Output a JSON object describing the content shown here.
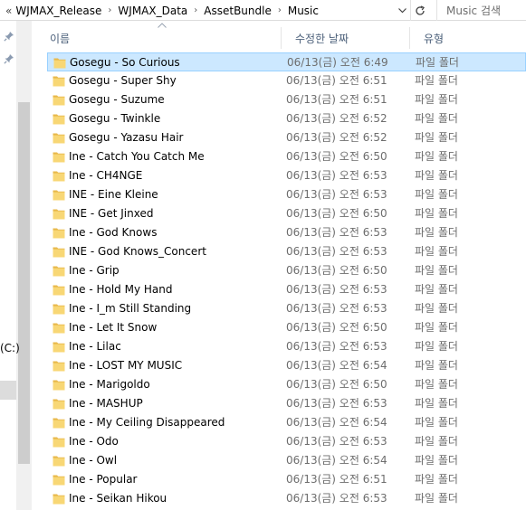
{
  "address": {
    "lead": "«",
    "crumbs": [
      "WJMAX_Release",
      "WJMAX_Data",
      "AssetBundle",
      "Music"
    ],
    "separator": "›"
  },
  "search": {
    "placeholder": "Music 검색"
  },
  "nav": {
    "drive_label": "(C:)"
  },
  "columns": {
    "name": "이름",
    "date": "수정한 날짜",
    "type": "유형"
  },
  "files": [
    {
      "name": "Gosegu - So Curious",
      "date": "06/13(금) 오전 6:49",
      "type": "파일 폴더"
    },
    {
      "name": "Gosegu - Super Shy",
      "date": "06/13(금) 오전 6:51",
      "type": "파일 폴더"
    },
    {
      "name": "Gosegu - Suzume",
      "date": "06/13(금) 오전 6:51",
      "type": "파일 폴더"
    },
    {
      "name": "Gosegu - Twinkle",
      "date": "06/13(금) 오전 6:52",
      "type": "파일 폴더"
    },
    {
      "name": "Gosegu - Yazasu Hair",
      "date": "06/13(금) 오전 6:52",
      "type": "파일 폴더"
    },
    {
      "name": "Ine - Catch You Catch Me",
      "date": "06/13(금) 오전 6:50",
      "type": "파일 폴더"
    },
    {
      "name": "Ine - CH4NGE",
      "date": "06/13(금) 오전 6:53",
      "type": "파일 폴더"
    },
    {
      "name": "INE - Eine Kleine",
      "date": "06/13(금) 오전 6:53",
      "type": "파일 폴더"
    },
    {
      "name": "INE - Get Jinxed",
      "date": "06/13(금) 오전 6:50",
      "type": "파일 폴더"
    },
    {
      "name": "Ine - God Knows",
      "date": "06/13(금) 오전 6:53",
      "type": "파일 폴더"
    },
    {
      "name": "INE - God Knows_Concert",
      "date": "06/13(금) 오전 6:53",
      "type": "파일 폴더"
    },
    {
      "name": "Ine - Grip",
      "date": "06/13(금) 오전 6:50",
      "type": "파일 폴더"
    },
    {
      "name": "Ine - Hold My Hand",
      "date": "06/13(금) 오전 6:53",
      "type": "파일 폴더"
    },
    {
      "name": "Ine - I_m Still Standing",
      "date": "06/13(금) 오전 6:53",
      "type": "파일 폴더"
    },
    {
      "name": "Ine - Let It Snow",
      "date": "06/13(금) 오전 6:50",
      "type": "파일 폴더"
    },
    {
      "name": "Ine - Lilac",
      "date": "06/13(금) 오전 6:53",
      "type": "파일 폴더"
    },
    {
      "name": "Ine - LOST MY MUSIC",
      "date": "06/13(금) 오전 6:54",
      "type": "파일 폴더"
    },
    {
      "name": "Ine - Marigoldo",
      "date": "06/13(금) 오전 6:50",
      "type": "파일 폴더"
    },
    {
      "name": "Ine - MASHUP",
      "date": "06/13(금) 오전 6:53",
      "type": "파일 폴더"
    },
    {
      "name": "Ine - My Ceiling Disappeared",
      "date": "06/13(금) 오전 6:54",
      "type": "파일 폴더"
    },
    {
      "name": "Ine - Odo",
      "date": "06/13(금) 오전 6:53",
      "type": "파일 폴더"
    },
    {
      "name": "Ine - Owl",
      "date": "06/13(금) 오전 6:54",
      "type": "파일 폴더"
    },
    {
      "name": "Ine - Popular",
      "date": "06/13(금) 오전 6:51",
      "type": "파일 폴더"
    },
    {
      "name": "Ine - Seikan Hikou",
      "date": "06/13(금) 오전 6:53",
      "type": "파일 폴더"
    }
  ],
  "colors": {
    "folder": "#f8d775",
    "folder_dark": "#e8b84a",
    "selected": "#cce8ff",
    "header_text": "#4c607a"
  }
}
